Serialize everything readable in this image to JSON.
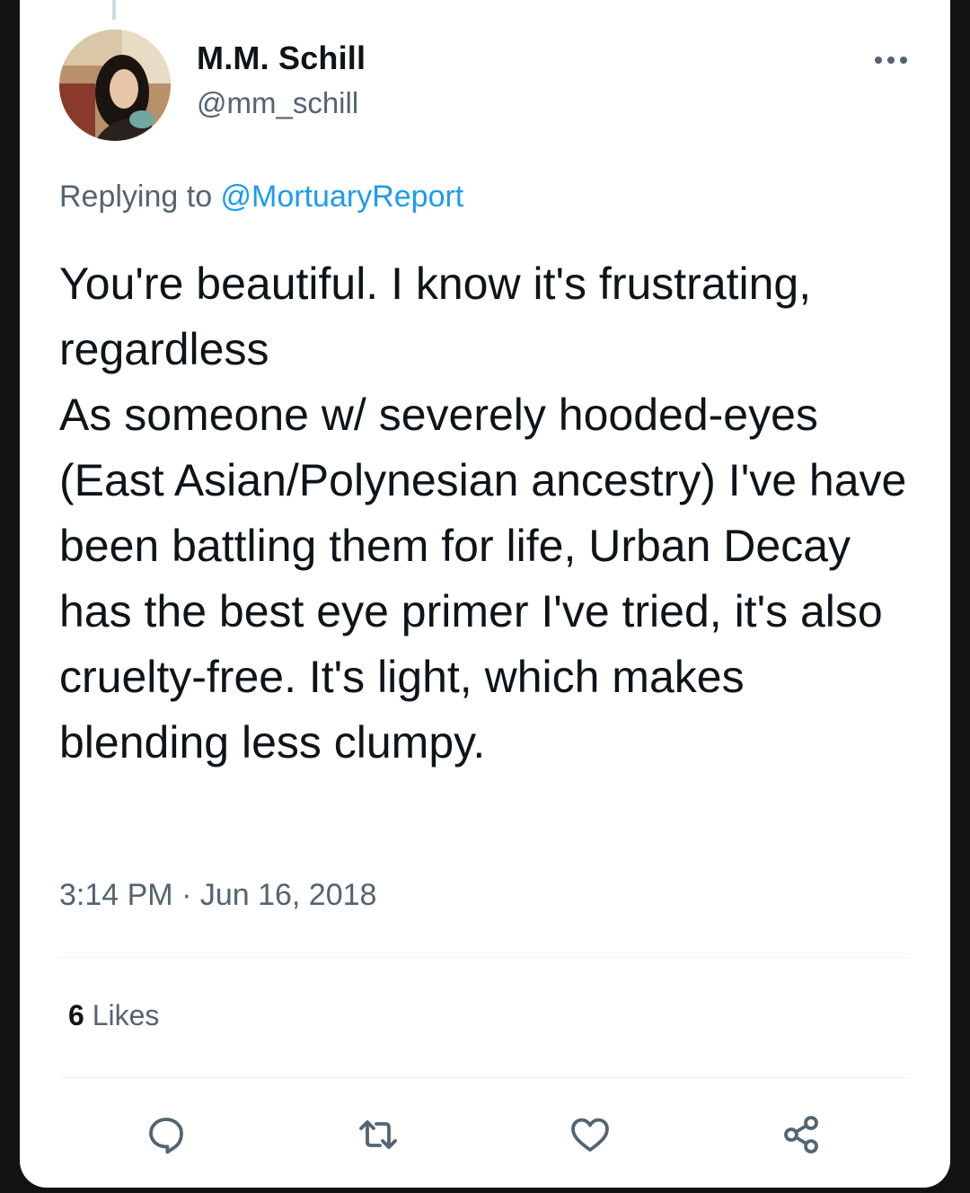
{
  "author": {
    "display_name": "M.M. Schill",
    "handle": "@mm_schill",
    "avatar_icon": "profile-photo"
  },
  "reply": {
    "prefix": "Replying to ",
    "target": "@MortuaryReport"
  },
  "tweet": {
    "text": "You're beautiful. I know it's frustrating, regardless\nAs someone w/ severely hooded-eyes (East Asian/Polynesian ancestry) I've have been battling them for life, Urban Decay has the best eye primer I've tried, it's also cruelty-free. It's light, which makes blending less clumpy.",
    "timestamp": "3:14 PM · Jun 16, 2018"
  },
  "stats": {
    "likes_count": "6",
    "likes_label": " Likes"
  },
  "actions": {
    "icons": [
      "reply-icon",
      "retweet-icon",
      "like-icon",
      "share-icon"
    ]
  },
  "colors": {
    "link": "#1d9bf0",
    "secondary_text": "#536471",
    "primary_text": "#0f1419"
  }
}
